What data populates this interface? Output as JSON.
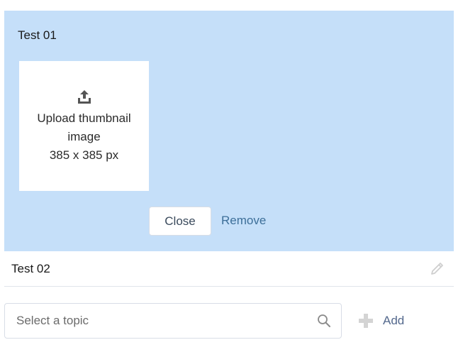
{
  "expanded_item": {
    "title": "Test 01",
    "upload": {
      "icon": "upload-icon",
      "line1": "Upload thumbnail",
      "line2": "image",
      "size_hint": "385 x 385 px"
    },
    "close_label": "Close",
    "remove_label": "Remove",
    "panel_color": "#c5dff9"
  },
  "items": [
    {
      "label": "Test 02",
      "action_icon": "pencil-icon"
    }
  ],
  "topic": {
    "placeholder": "Select a topic",
    "value": "",
    "icon": "search-icon",
    "add_label": "Add",
    "add_icon": "plus-icon"
  },
  "colors": {
    "link": "#3d6f99",
    "muted_icon": "#c9c9c9"
  }
}
